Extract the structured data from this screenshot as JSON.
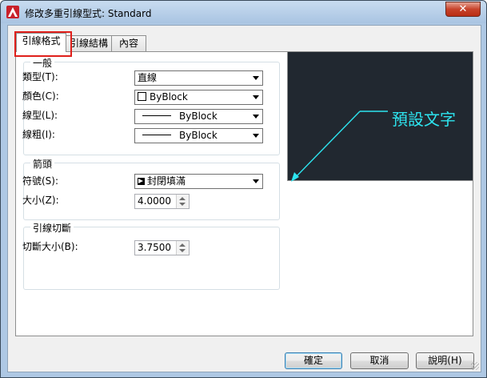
{
  "window": {
    "title": "修改多重引線型式: Standard",
    "close_glyph": "✕"
  },
  "tabs": [
    {
      "label": "引線格式"
    },
    {
      "label": "引線結構"
    },
    {
      "label": "內容"
    }
  ],
  "general": {
    "title": "一般",
    "type_label": "類型(T):",
    "type_value": "直線",
    "color_label": "顏色(C):",
    "color_value": "ByBlock",
    "linetype_label": "線型(L):",
    "linetype_value": "ByBlock",
    "lineweight_label": "線粗(I):",
    "lineweight_value": "ByBlock"
  },
  "arrowhead": {
    "title": "箭頭",
    "symbol_label": "符號(S):",
    "symbol_value": "封閉填滿",
    "size_label": "大小(Z):",
    "size_value": "4.0000"
  },
  "landing_break": {
    "title": "引線切斷",
    "break_size_label": "切斷大小(B):",
    "break_size_value": "3.7500"
  },
  "preview": {
    "text": "預設文字",
    "color": "#2de5f0",
    "background": "#212830"
  },
  "buttons": {
    "ok": "確定",
    "cancel": "取消",
    "help": "說明(H)"
  }
}
